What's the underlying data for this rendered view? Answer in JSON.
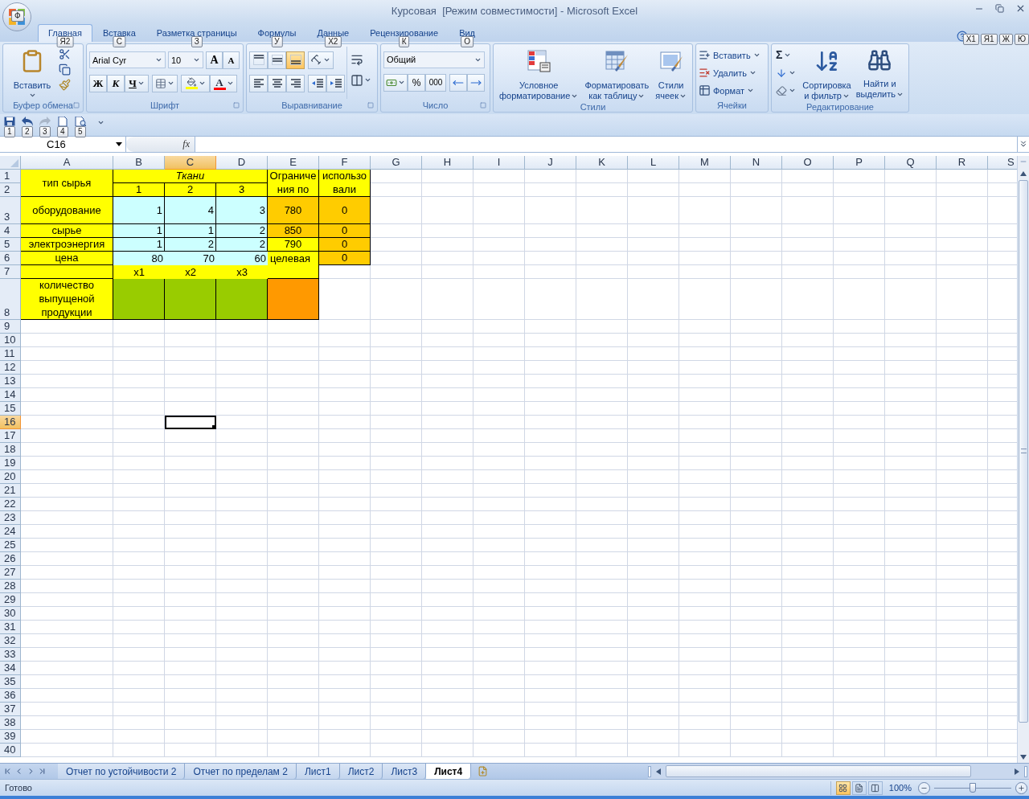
{
  "window": {
    "title": "Курсовая  [Режим совместимости] - Microsoft Excel",
    "office_keytip": "Ф"
  },
  "tabs": [
    {
      "label": "Главная",
      "keytip": "Я2",
      "selected": true
    },
    {
      "label": "Вставка",
      "keytip": "С",
      "selected": false
    },
    {
      "label": "Разметка страницы",
      "keytip": "З",
      "selected": false
    },
    {
      "label": "Формулы",
      "keytip": "У",
      "selected": false
    },
    {
      "label": "Данные",
      "keytip": "Х2",
      "selected": false
    },
    {
      "label": "Рецензирование",
      "keytip": "К",
      "selected": false
    },
    {
      "label": "Вид",
      "keytip": "О",
      "selected": false
    }
  ],
  "window_keytips": [
    "Х1",
    "Я1",
    "Ж",
    "Ю"
  ],
  "clipboard": {
    "label": "Буфер обмена",
    "paste": "Вставить"
  },
  "font": {
    "label": "Шрифт",
    "name": "Arial Cyr",
    "size": "10",
    "grow": "A",
    "shrink": "A",
    "bold": "Ж",
    "italic": "К",
    "underline": "Ч",
    "color_letter": "A"
  },
  "alignment": {
    "label": "Выравнивание",
    "vertical": [
      {
        "selected": false
      },
      {
        "selected": false
      },
      {
        "selected": true
      }
    ],
    "horizontal": [
      {
        "selected": false
      },
      {
        "selected": false
      },
      {
        "selected": false
      }
    ]
  },
  "number": {
    "label": "Число",
    "format": "Общий",
    "percent": "%",
    "thousands": "000"
  },
  "styles": {
    "label": "Стили",
    "buttons": [
      {
        "kind": "conditional",
        "lines": [
          "Условное",
          "форматирование"
        ]
      },
      {
        "kind": "table",
        "lines": [
          "Форматировать",
          "как таблицу"
        ]
      },
      {
        "kind": "cell",
        "lines": [
          "Стили",
          "ячеек"
        ]
      }
    ]
  },
  "cells_group": {
    "label": "Ячейки",
    "buttons": [
      {
        "kind": "insert",
        "label": "Вставить"
      },
      {
        "kind": "delete",
        "label": "Удалить"
      },
      {
        "kind": "format",
        "label": "Формат"
      }
    ]
  },
  "editing": {
    "label": "Редактирование",
    "sum": "Σ",
    "buttons": [
      {
        "kind": "sort",
        "lines": [
          "Сортировка",
          "и фильтр"
        ]
      },
      {
        "kind": "find",
        "lines": [
          "Найти и",
          "выделить"
        ]
      }
    ]
  },
  "quick_access": [
    {
      "kind": "save",
      "keytip": "1",
      "disabled": false
    },
    {
      "kind": "undo",
      "keytip": "2",
      "disabled": false
    },
    {
      "kind": "redo",
      "keytip": "3",
      "disabled": true
    },
    {
      "kind": "new",
      "keytip": "4",
      "disabled": false
    },
    {
      "kind": "preview",
      "keytip": "5",
      "disabled": false
    }
  ],
  "formula_bar": {
    "name_box": "C16",
    "fx": "fx"
  },
  "sheet": {
    "columns": [
      {
        "label": "A",
        "selected": false
      },
      {
        "label": "B",
        "selected": false
      },
      {
        "label": "C",
        "selected": true
      },
      {
        "label": "D",
        "selected": false
      },
      {
        "label": "E",
        "selected": false
      },
      {
        "label": "F",
        "selected": false
      },
      {
        "label": "G",
        "selected": false
      },
      {
        "label": "H",
        "selected": false
      },
      {
        "label": "I",
        "selected": false
      },
      {
        "label": "J",
        "selected": false
      },
      {
        "label": "K",
        "selected": false
      },
      {
        "label": "L",
        "selected": false
      },
      {
        "label": "M",
        "selected": false
      },
      {
        "label": "N",
        "selected": false
      },
      {
        "label": "O",
        "selected": false
      },
      {
        "label": "P",
        "selected": false
      },
      {
        "label": "Q",
        "selected": false
      },
      {
        "label": "R",
        "selected": false
      },
      {
        "label": "S",
        "selected": false
      }
    ],
    "rows": [
      {
        "number": "1",
        "selected": false,
        "cells": [
          {
            "text": "тип сырья",
            "kind": "label",
            "color": "#ffff00",
            "bordered": true
          },
          {
            "text": "Ткани",
            "kind": "title",
            "color": "#ffff00",
            "bordered": true
          },
          {
            "kind": "merged_left"
          },
          {
            "kind": "merged_left"
          },
          {
            "lines": [
              "Ограниче",
              "ния по"
            ],
            "kind": "label",
            "color": "#ffff00",
            "bordered": true
          },
          {
            "lines": [
              "использо",
              "вали"
            ],
            "kind": "label",
            "color": "#ffff00",
            "bordered": true
          }
        ]
      },
      {
        "number": "2",
        "selected": false,
        "cells": [
          {
            "kind": "merged_up"
          },
          {
            "text": "1",
            "kind": "label",
            "color": "#ffff00",
            "bordered": true
          },
          {
            "text": "2",
            "kind": "label",
            "color": "#ffff00",
            "bordered": true
          },
          {
            "text": "3",
            "kind": "label",
            "color": "#ffff00",
            "bordered": true
          },
          {
            "kind": "merged_up"
          },
          {
            "kind": "merged_up"
          }
        ]
      },
      {
        "number": "3",
        "selected": false,
        "cells": [
          {
            "text": "оборудование",
            "kind": "label",
            "color": "#ffff00",
            "bordered": true
          },
          {
            "text": "1",
            "kind": "number",
            "color": "#ccffff",
            "bordered": true
          },
          {
            "text": "4",
            "kind": "number",
            "color": "#ccffff",
            "bordered": true
          },
          {
            "text": "3",
            "kind": "number",
            "color": "#ccffff",
            "bordered": true
          },
          {
            "text": "780",
            "kind": "label",
            "color": "#ffcc00",
            "bordered": true
          },
          {
            "text": "0",
            "kind": "label",
            "color": "#ffcc00",
            "bordered": true
          }
        ]
      },
      {
        "number": "4",
        "selected": false,
        "cells": [
          {
            "text": "сырье",
            "kind": "label",
            "color": "#ffff00",
            "bordered": true
          },
          {
            "text": "1",
            "kind": "number",
            "color": "#ccffff",
            "bordered": true
          },
          {
            "text": "1",
            "kind": "number",
            "color": "#ccffff",
            "bordered": true
          },
          {
            "text": "2",
            "kind": "number",
            "color": "#ccffff",
            "bordered": true
          },
          {
            "text": "850",
            "kind": "label",
            "color": "#ffcc00",
            "bordered": true
          },
          {
            "text": "0",
            "kind": "label",
            "color": "#ffcc00",
            "bordered": true
          }
        ]
      },
      {
        "number": "5",
        "selected": false,
        "cells": [
          {
            "text": "электроэнергия",
            "kind": "label",
            "color": "#ffff00",
            "bordered": true
          },
          {
            "text": "1",
            "kind": "number",
            "color": "#ccffff",
            "bordered": true
          },
          {
            "text": "2",
            "kind": "number",
            "color": "#ccffff",
            "bordered": true
          },
          {
            "text": "2",
            "kind": "number",
            "color": "#ccffff",
            "bordered": true
          },
          {
            "text": "790",
            "kind": "label",
            "color": "#ffff00",
            "bordered": true
          },
          {
            "text": "0",
            "kind": "label",
            "color": "#ffcc00",
            "bordered": true
          }
        ]
      },
      {
        "number": "6",
        "selected": false,
        "cells": [
          {
            "text": "цена",
            "kind": "label",
            "color": "#ffff00",
            "bordered": true
          },
          {
            "text": "80",
            "kind": "number",
            "color": "#ccffff",
            "bordered": false
          },
          {
            "text": "70",
            "kind": "number",
            "color": "#ccffff",
            "bordered": false
          },
          {
            "text": "60",
            "kind": "number",
            "color": "#ccffff",
            "bordered": false
          },
          {
            "text": "целевая",
            "kind": "note",
            "color": "#ffff00",
            "bordered": true
          },
          {
            "text": "0",
            "kind": "label",
            "color": "#ffcc00",
            "bordered": true
          }
        ]
      },
      {
        "number": "7",
        "selected": false,
        "cells": [
          {
            "kind": "label",
            "color": "#ffff00",
            "bordered": true
          },
          {
            "text": "x1",
            "kind": "label",
            "color": "#ffff00",
            "bordered": false
          },
          {
            "text": "x2",
            "kind": "label",
            "color": "#ffff00",
            "bordered": false
          },
          {
            "text": "x3",
            "kind": "label",
            "color": "#ffff00",
            "bordered": false
          },
          {
            "kind": "merged_up"
          }
        ]
      },
      {
        "number": "8",
        "selected": false,
        "cells": [
          {
            "lines": [
              "количество",
              "выпущеной",
              "продукции"
            ],
            "kind": "label",
            "color": "#ffff00",
            "bordered": true
          },
          {
            "kind": "label",
            "color": "#99cc00",
            "bordered": true
          },
          {
            "kind": "label",
            "color": "#99cc00",
            "bordered": true
          },
          {
            "kind": "label",
            "color": "#99cc00",
            "bordered": true
          },
          {
            "kind": "label",
            "color": "#ff9900",
            "bordered": true
          }
        ]
      },
      {
        "number": "9",
        "selected": false
      },
      {
        "number": "10",
        "selected": false
      },
      {
        "number": "11",
        "selected": false
      },
      {
        "number": "12",
        "selected": false
      },
      {
        "number": "13",
        "selected": false
      },
      {
        "number": "14",
        "selected": false
      },
      {
        "number": "15",
        "selected": false
      },
      {
        "number": "16",
        "selected": true
      },
      {
        "number": "17",
        "selected": false
      },
      {
        "number": "18",
        "selected": false
      },
      {
        "number": "19",
        "selected": false
      },
      {
        "number": "20",
        "selected": false
      },
      {
        "number": "21",
        "selected": false
      },
      {
        "number": "22",
        "selected": false
      },
      {
        "number": "23",
        "selected": false
      },
      {
        "number": "24",
        "selected": false
      },
      {
        "number": "25",
        "selected": false
      },
      {
        "number": "26",
        "selected": false
      },
      {
        "number": "27",
        "selected": false
      },
      {
        "number": "28",
        "selected": false
      },
      {
        "number": "29",
        "selected": false
      },
      {
        "number": "30",
        "selected": false
      },
      {
        "number": "31",
        "selected": false
      },
      {
        "number": "32",
        "selected": false
      },
      {
        "number": "33",
        "selected": false
      },
      {
        "number": "34",
        "selected": false
      },
      {
        "number": "35",
        "selected": false
      },
      {
        "number": "36",
        "selected": false
      },
      {
        "number": "37",
        "selected": false
      },
      {
        "number": "38",
        "selected": false
      },
      {
        "number": "39",
        "selected": false
      },
      {
        "number": "40",
        "selected": false
      }
    ]
  },
  "sheet_tabs": [
    {
      "label": "Отчет по устойчивости 2",
      "selected": false
    },
    {
      "label": "Отчет по пределам 2",
      "selected": false
    },
    {
      "label": "Лист1",
      "selected": false
    },
    {
      "label": "Лист2",
      "selected": false
    },
    {
      "label": "Лист3",
      "selected": false
    },
    {
      "label": "Лист4",
      "selected": true
    }
  ],
  "status_bar": {
    "status": "Готово",
    "views": [
      {
        "selected": true
      },
      {
        "selected": false
      },
      {
        "selected": false
      }
    ],
    "zoom": "100%",
    "level": 0.5
  }
}
